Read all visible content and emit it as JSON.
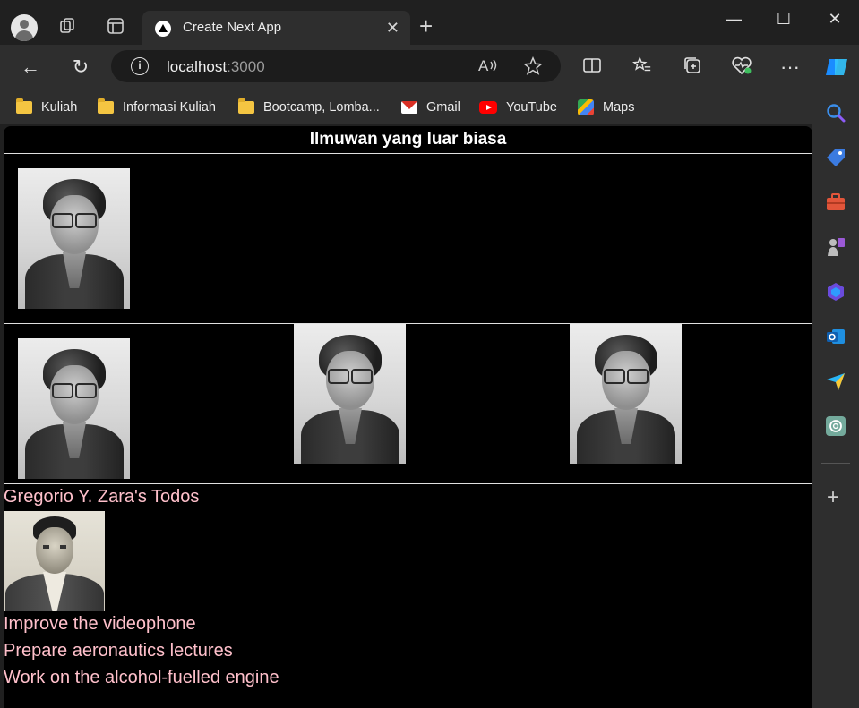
{
  "browser": {
    "tab_title": "Create Next App",
    "tab_close": "✕",
    "new_tab": "+",
    "address_host": "localhost",
    "address_port": ":3000",
    "info_glyph": "i",
    "window_controls": {
      "minimize": "—",
      "maximize": "☐",
      "close": "✕"
    },
    "nav": {
      "back": "←",
      "refresh": "↻",
      "more": "···"
    }
  },
  "bookmarks": [
    {
      "label": "Kuliah",
      "icon": "folder-icon"
    },
    {
      "label": "Informasi Kuliah",
      "icon": "folder-icon"
    },
    {
      "label": "Bootcamp, Lomba...",
      "icon": "folder-icon"
    },
    {
      "label": "Gmail",
      "icon": "gmail-icon"
    },
    {
      "label": "YouTube",
      "icon": "youtube-icon"
    },
    {
      "label": "Maps",
      "icon": "maps-icon"
    }
  ],
  "sidebar": {
    "icons": [
      "search-icon",
      "tag-icon",
      "toolbox-icon",
      "games-icon",
      "copilot-icon",
      "outlook-icon",
      "send-icon",
      "chatgpt-icon"
    ],
    "add": "+"
  },
  "page": {
    "heading": "Ilmuwan yang luar biasa",
    "todo_title": "Gregorio Y. Zara's Todos",
    "todos": [
      "Improve the videophone",
      "Prepare aeronautics lectures",
      "Work on the alcohol-fuelled engine"
    ]
  }
}
